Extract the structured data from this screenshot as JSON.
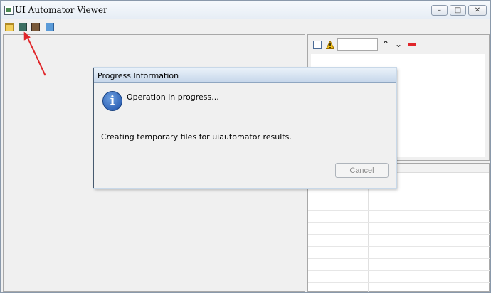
{
  "window": {
    "title": "UI Automator Viewer",
    "controls": {
      "minimize": "–",
      "maximize": "□",
      "close": "✕"
    }
  },
  "toolbar": {
    "items": [
      "open-folder-icon",
      "device-screenshot-icon",
      "device-screenshot-compressed-icon",
      "save-icon"
    ]
  },
  "right_panel": {
    "tree_toolbar": [
      "expand-all-icon",
      "warning-icon",
      "search-field",
      "up-arrow-icon",
      "down-arrow-icon",
      "clear-icon"
    ],
    "search_value": ""
  },
  "annotation": {
    "color": "#e0262a"
  },
  "dialog": {
    "title": "Progress Information",
    "message": "Operation in progress...",
    "detail": "Creating temporary files for uiautomator results.",
    "cancel_label": "Cancel",
    "cancel_enabled": false
  },
  "colors": {
    "accent": "#1c4fa8",
    "annotation": "#e0262a"
  }
}
